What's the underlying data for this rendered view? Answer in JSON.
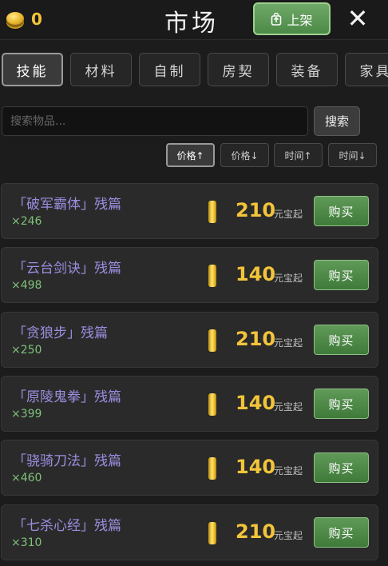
{
  "header": {
    "currency_count": "0",
    "title": "市场",
    "list_button_label": "上架",
    "close_label": "✕"
  },
  "tabs": [
    {
      "label": "技能",
      "active": true
    },
    {
      "label": "材料",
      "active": false
    },
    {
      "label": "自制",
      "active": false
    },
    {
      "label": "房契",
      "active": false
    },
    {
      "label": "装备",
      "active": false
    },
    {
      "label": "家具",
      "active": false
    }
  ],
  "search": {
    "placeholder": "搜索物品...",
    "value": "",
    "button_label": "搜索"
  },
  "sort": [
    {
      "label": "价格↑",
      "active": true
    },
    {
      "label": "价格↓",
      "active": false
    },
    {
      "label": "时间↑",
      "active": false
    },
    {
      "label": "时间↓",
      "active": false
    }
  ],
  "listings": [
    {
      "name": "「破军霸体」残篇",
      "qty": "×246",
      "price": "210",
      "unit": "元宝起",
      "buy_label": "购买"
    },
    {
      "name": "「云台剑诀」残篇",
      "qty": "×498",
      "price": "140",
      "unit": "元宝起",
      "buy_label": "购买"
    },
    {
      "name": "「贪狼步」残篇",
      "qty": "×250",
      "price": "210",
      "unit": "元宝起",
      "buy_label": "购买"
    },
    {
      "name": "「原陵鬼拳」残篇",
      "qty": "×399",
      "price": "140",
      "unit": "元宝起",
      "buy_label": "购买"
    },
    {
      "name": "「骁骑刀法」残篇",
      "qty": "×460",
      "price": "140",
      "unit": "元宝起",
      "buy_label": "购买"
    },
    {
      "name": "「七杀心经」残篇",
      "qty": "×310",
      "price": "210",
      "unit": "元宝起",
      "buy_label": "购买"
    }
  ],
  "colors": {
    "accent_green": "#4c8a47",
    "gold": "#f2c43a",
    "item_name": "#9a8ee0",
    "quantity": "#7fc27a"
  }
}
